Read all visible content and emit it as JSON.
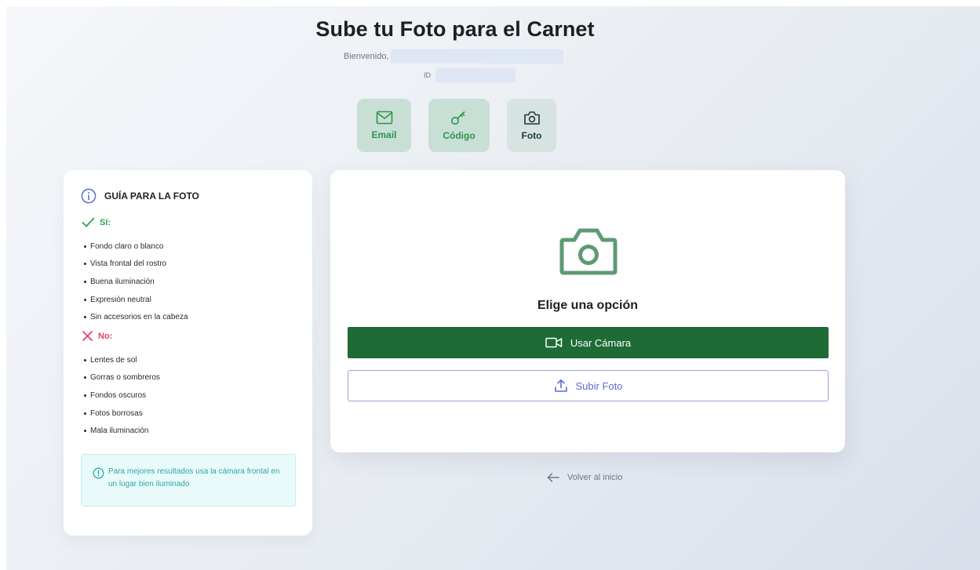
{
  "header": {
    "title": "Sube tu Foto para el Carnet",
    "welcome_label": "Bienvenido,",
    "id_label": "ID"
  },
  "steps": [
    {
      "label": "Email",
      "icon": "mail-icon",
      "state": "completed"
    },
    {
      "label": "Código",
      "icon": "key-icon",
      "state": "completed"
    },
    {
      "label": "Foto",
      "icon": "camera-icon",
      "state": "active"
    }
  ],
  "guide": {
    "title": "GUÍA PARA LA FOTO",
    "yes_label": "Sí:",
    "yes_items": [
      "Fondo claro o blanco",
      "Vista frontal del rostro",
      "Buena iluminación",
      "Expresión neutral",
      "Sin accesorios en la cabeza"
    ],
    "no_label": "No:",
    "no_items": [
      "Lentes de sol",
      "Gorras o sombreros",
      "Fondos oscuros",
      "Fotos borrosas",
      "Mala iluminación"
    ],
    "tip": "Para mejores resultados usa la cámara frontal en un lugar bien iluminado"
  },
  "main": {
    "choose_title": "Elige una opción",
    "camera_button": "Usar Cámara",
    "upload_button": "Subir Foto"
  },
  "back_link": "Volver al inicio",
  "colors": {
    "primary_green": "#1e6b35",
    "step_green": "#2f9447",
    "yes_green": "#27a34b",
    "no_red": "#e24363",
    "upload_blue": "#5b6ad8",
    "tip_teal": "#2fa6a6"
  }
}
